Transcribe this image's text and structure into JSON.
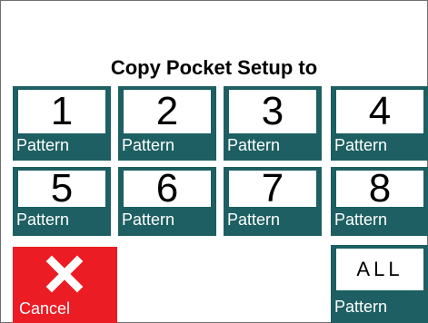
{
  "dialog": {
    "title": "Copy Pocket Setup to"
  },
  "pockets": [
    {
      "number": "1",
      "label": "Pattern"
    },
    {
      "number": "2",
      "label": "Pattern"
    },
    {
      "number": "3",
      "label": "Pattern"
    },
    {
      "number": "4",
      "label": "Pattern"
    },
    {
      "number": "5",
      "label": "Pattern"
    },
    {
      "number": "6",
      "label": "Pattern"
    },
    {
      "number": "7",
      "label": "Pattern"
    },
    {
      "number": "8",
      "label": "Pattern"
    }
  ],
  "all_button": {
    "text": "ALL",
    "label": "Pattern"
  },
  "cancel_button": {
    "label": "Cancel",
    "icon": "close-icon"
  },
  "colors": {
    "tile": "#1d5f62",
    "cancel": "#ec1c24"
  }
}
